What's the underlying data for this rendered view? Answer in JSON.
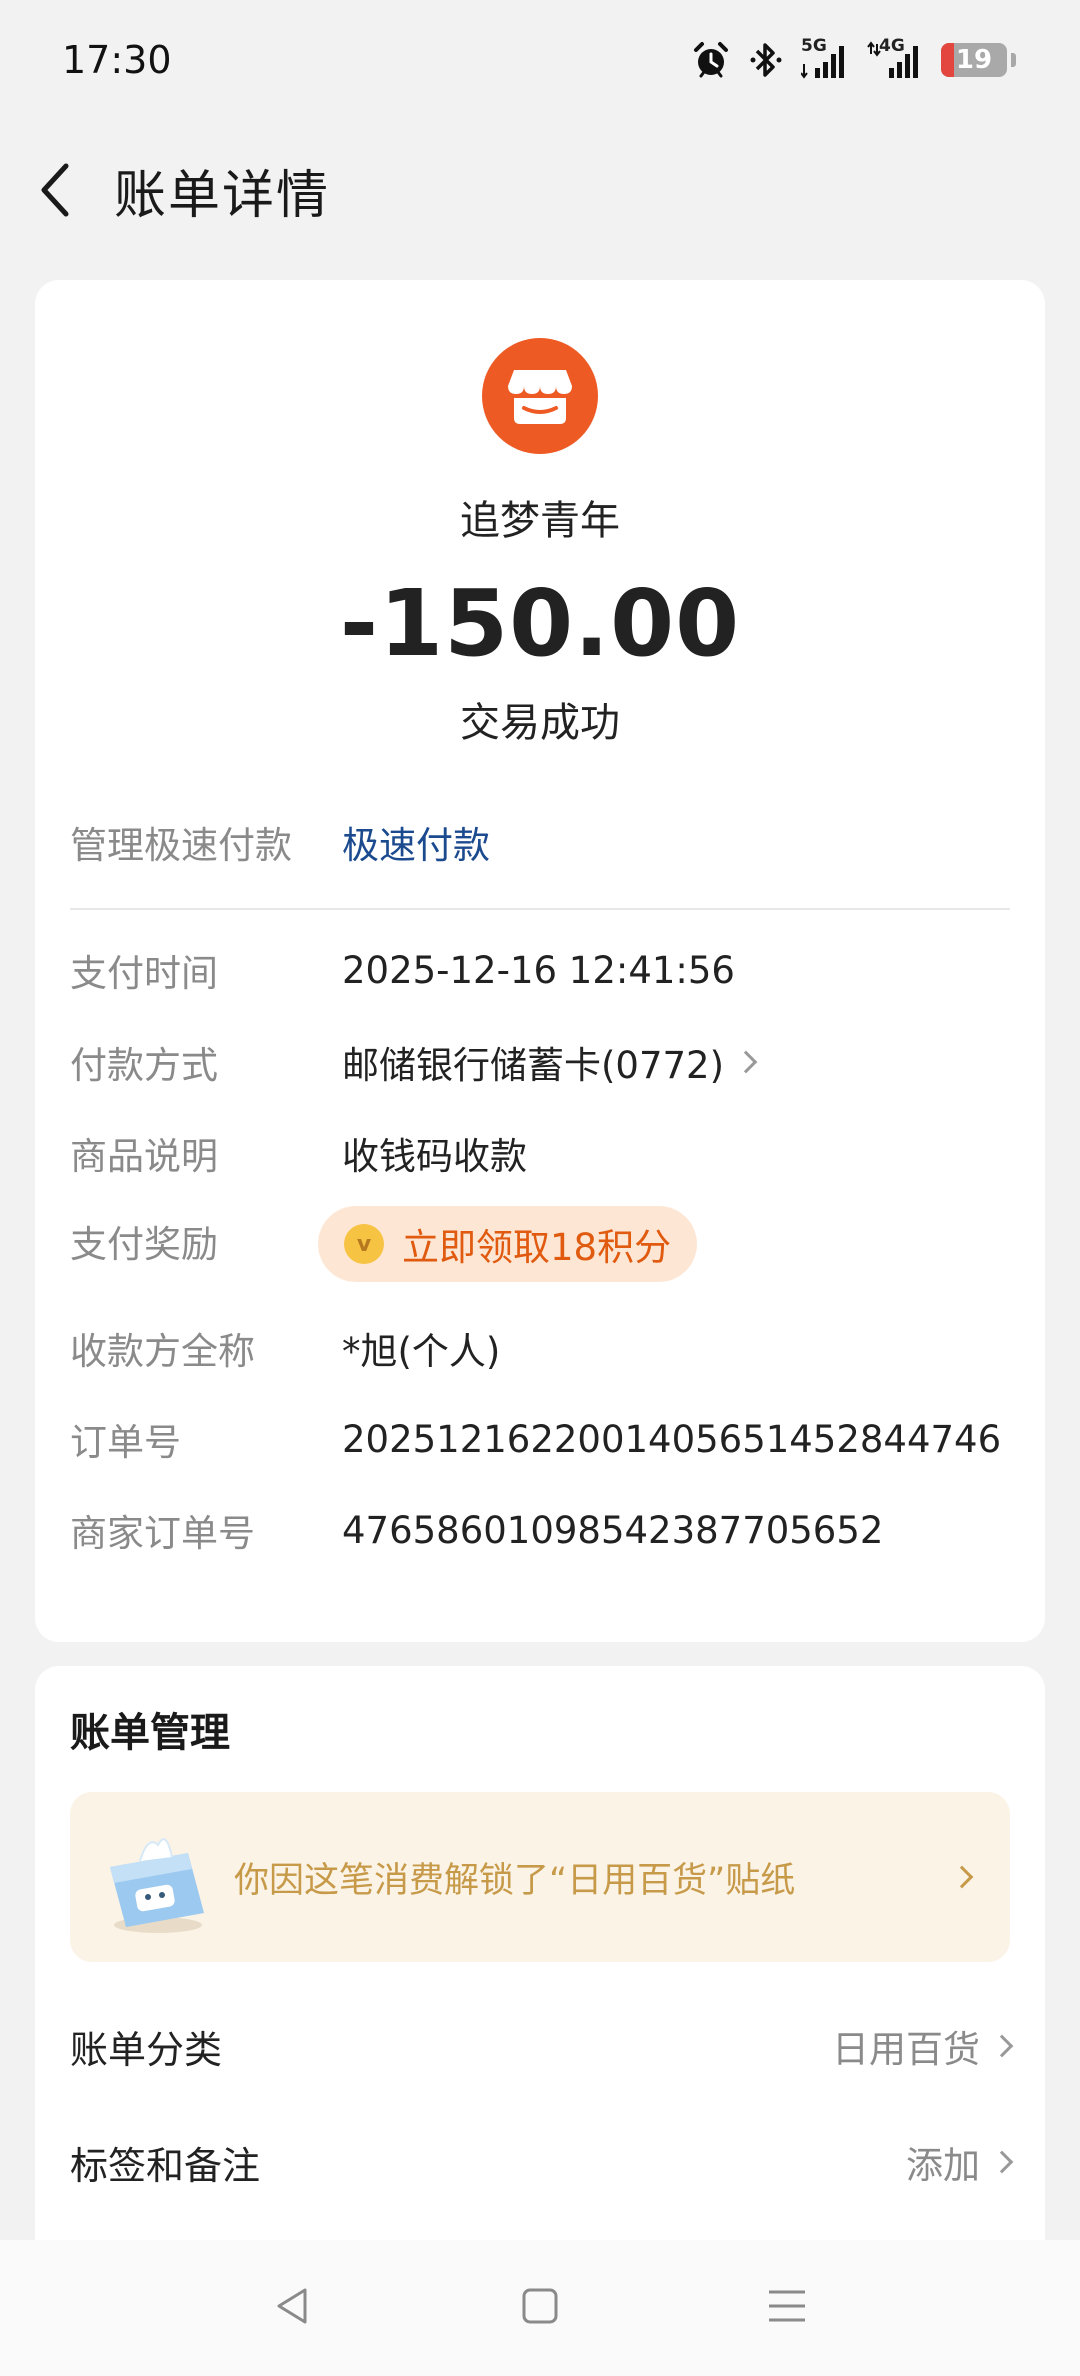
{
  "status_bar": {
    "time": "17:30",
    "icons": [
      "alarm-icon",
      "bluetooth-icon",
      "signal-5g-icon",
      "signal-4g-icon"
    ],
    "network_1": "5G",
    "network_2": "4G",
    "battery_level": "19",
    "battery_fraction": 0.19,
    "battery_color": "#e3463f"
  },
  "header": {
    "title": "账单详情",
    "back_icon": "chevron-left-icon"
  },
  "transaction": {
    "merchant_name": "追梦青年",
    "merchant_icon": "store-icon",
    "merchant_icon_color": "#ee5a24",
    "amount": "-150.00",
    "status": "交易成功"
  },
  "quick_pay": {
    "label": "管理极速付款",
    "value": "极速付款",
    "value_color": "#1b4a8f"
  },
  "details": [
    {
      "label": "支付时间",
      "value": "2025-12-16 12:41:56"
    },
    {
      "label": "付款方式",
      "value": "邮储银行储蓄卡(0772)"
    },
    {
      "label": "商品说明",
      "value": "收钱码收款"
    },
    {
      "label": "支付奖励",
      "value": "立即领取18积分"
    },
    {
      "label": "收款方全称",
      "value": "*旭(个人)"
    },
    {
      "label": "订单号",
      "value": "2025121622001405651452844746"
    },
    {
      "label": "商家订单号",
      "value": "4765860109854238770565​2"
    }
  ],
  "reward": {
    "coin_glyph": "v",
    "accent": "#e05a10"
  },
  "bill_management": {
    "title": "账单管理",
    "sticker_banner": "你因这笔消费解锁了“日用百货”贴纸",
    "rows": [
      {
        "label": "账单分类",
        "value": "日用百货"
      },
      {
        "label": "标签和备注",
        "value": "添加"
      }
    ]
  },
  "nav_bar": {
    "icons": [
      "back-triangle-icon",
      "home-square-icon",
      "menu-lines-icon"
    ]
  }
}
